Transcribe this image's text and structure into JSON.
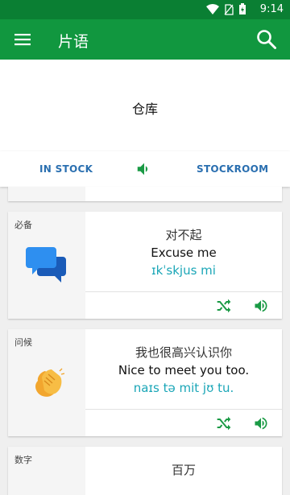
{
  "status": {
    "time": "9:14"
  },
  "appbar": {
    "title": "片语"
  },
  "header": {
    "word": "仓库"
  },
  "tabs": {
    "left": "IN STOCK",
    "right": "STOCKROOM"
  },
  "cards": [
    {
      "category": "必备",
      "cn": "对不起",
      "en": "Excuse me",
      "ipa": "ɪkˈskjus mi"
    },
    {
      "category": "问候",
      "cn": "我也很高兴认识你",
      "en": "Nice to meet you too.",
      "ipa": "naɪs tə mit jʊ tu."
    },
    {
      "category": "数字",
      "cn": "百万"
    }
  ],
  "colors": {
    "primary": "#11973f",
    "status": "#0a7f33",
    "tab_text": "#2a6fb0",
    "ipa": "#1aa6b7",
    "icon_green": "#1a9a45"
  }
}
